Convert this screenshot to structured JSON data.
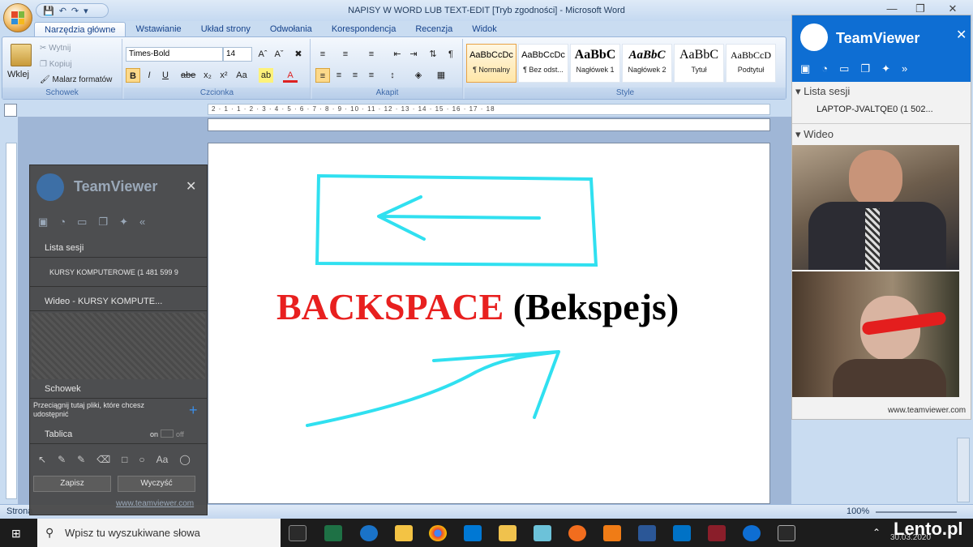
{
  "window": {
    "title": "NAPISY W WORD LUB TEXT-EDIT [Tryb zgodności] - Microsoft Word"
  },
  "tabs": [
    "Narzędzia główne",
    "Wstawianie",
    "Układ strony",
    "Odwołania",
    "Korespondencja",
    "Recenzja",
    "Widok"
  ],
  "clipboard": {
    "paste": "Wklej",
    "cut": "Wytnij",
    "copy": "Kopiuj",
    "painter": "Malarz formatów",
    "label": "Schowek"
  },
  "font": {
    "name": "Times-Bold",
    "size": "14",
    "label": "Czcionka"
  },
  "paragraph": {
    "label": "Akapit"
  },
  "styles": {
    "label": "Style",
    "items": [
      {
        "preview": "AaBbCcDc",
        "name": "¶ Normalny"
      },
      {
        "preview": "AaBbCcDc",
        "name": "¶ Bez odst..."
      },
      {
        "preview": "AaBbC",
        "name": "Nagłówek 1"
      },
      {
        "preview": "AaBbC",
        "name": "Nagłówek 2"
      },
      {
        "preview": "AaBbC",
        "name": "Tytuł"
      },
      {
        "preview": "AaBbCcD",
        "name": "Podtytuł"
      }
    ]
  },
  "document": {
    "word_red": "BACKSPACE",
    "word_black": "(Bekspejs)"
  },
  "ruler": {
    "ticks": "2 · 1 · 1 · 2 · 3 · 4 · 5 · 6 · 7 · 8 · 9 · 10 · 11 · 12 · 13 · 14 · 15 · 16 · 17 · 18"
  },
  "statusbar": {
    "left": "Strona",
    "zoom": "100%"
  },
  "tv_small": {
    "brand": "TeamViewer",
    "session_list": "Lista sesji",
    "session_item": "KURSY KOMPUTEROWE (1 481 599 9",
    "video": "Wideo - KURSY KOMPUTE...",
    "clipboard": "Schowek",
    "clipboard_hint": "Przeciągnij tutaj pliki, które chcesz udostępnić",
    "board": "Tablica",
    "board_on": "on",
    "board_off": "off",
    "save": "Zapisz",
    "clear": "Wyczyść",
    "link": "www.teamviewer.com"
  },
  "tv_right": {
    "brand": "TeamViewer",
    "session_list": "Lista sesji",
    "session_item": "LAPTOP-JVALTQE0 (1 502...",
    "video": "Wideo",
    "link": "www.teamviewer.com"
  },
  "taskbar": {
    "search_placeholder": "Wpisz tu wyszukiwane słowa",
    "date": "30.03.2020",
    "watermark": "Lento.pl"
  },
  "colors": {
    "accent": "#0e6ed3",
    "doc_red": "#e8201f",
    "cyan_stroke": "#30e0f0"
  }
}
